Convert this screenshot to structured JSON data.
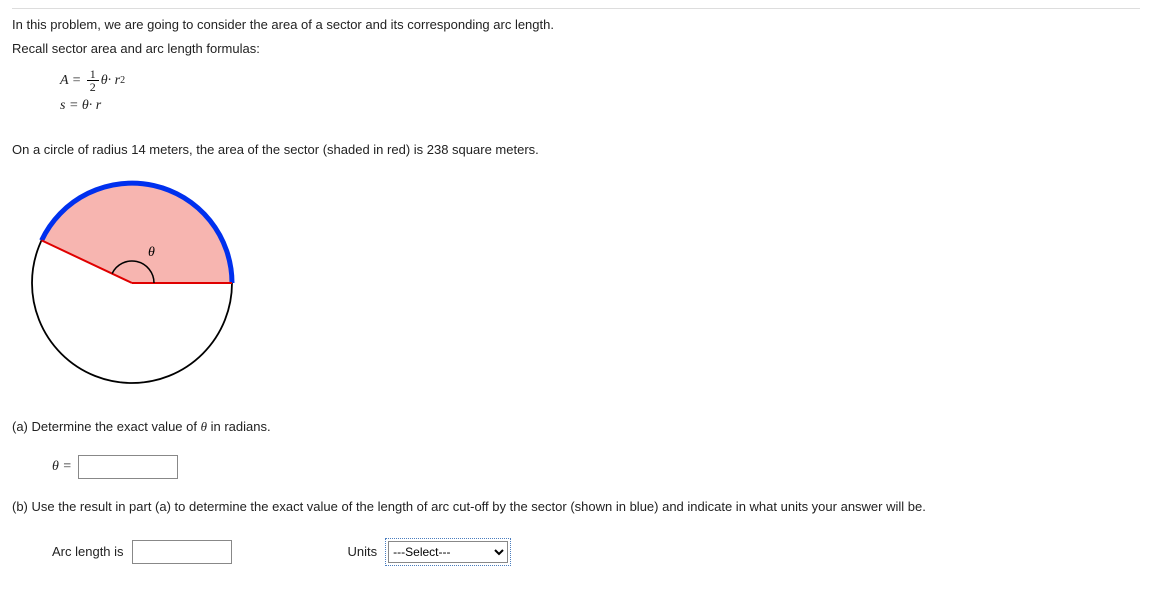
{
  "intro": {
    "line1": "In this problem, we are going to consider the area of a sector and its corresponding arc length.",
    "line2": "Recall sector area and arc length formulas:"
  },
  "formulas": {
    "area_lhs": "A =",
    "area_frac_num": "1",
    "area_frac_den": "2",
    "area_rhs": "θ· r",
    "area_exp": "2",
    "arc": "s = θ· r"
  },
  "statement": "On a circle of radius 14 meters, the area of the sector (shaded in red) is 238 square meters.",
  "diagram": {
    "theta_label": "θ"
  },
  "part_a": {
    "prompt_prefix": "(a) Determine the exact value of ",
    "prompt_theta": "θ",
    "prompt_suffix": "  in radians.",
    "answer_label": "θ ="
  },
  "part_b": {
    "prompt": "(b) Use the result in part (a) to determine the exact value of the length of arc cut-off by the sector (shown in blue) and indicate in what units your answer will be.",
    "arc_label": "Arc length is",
    "units_label": "Units",
    "select_placeholder": "---Select---"
  }
}
